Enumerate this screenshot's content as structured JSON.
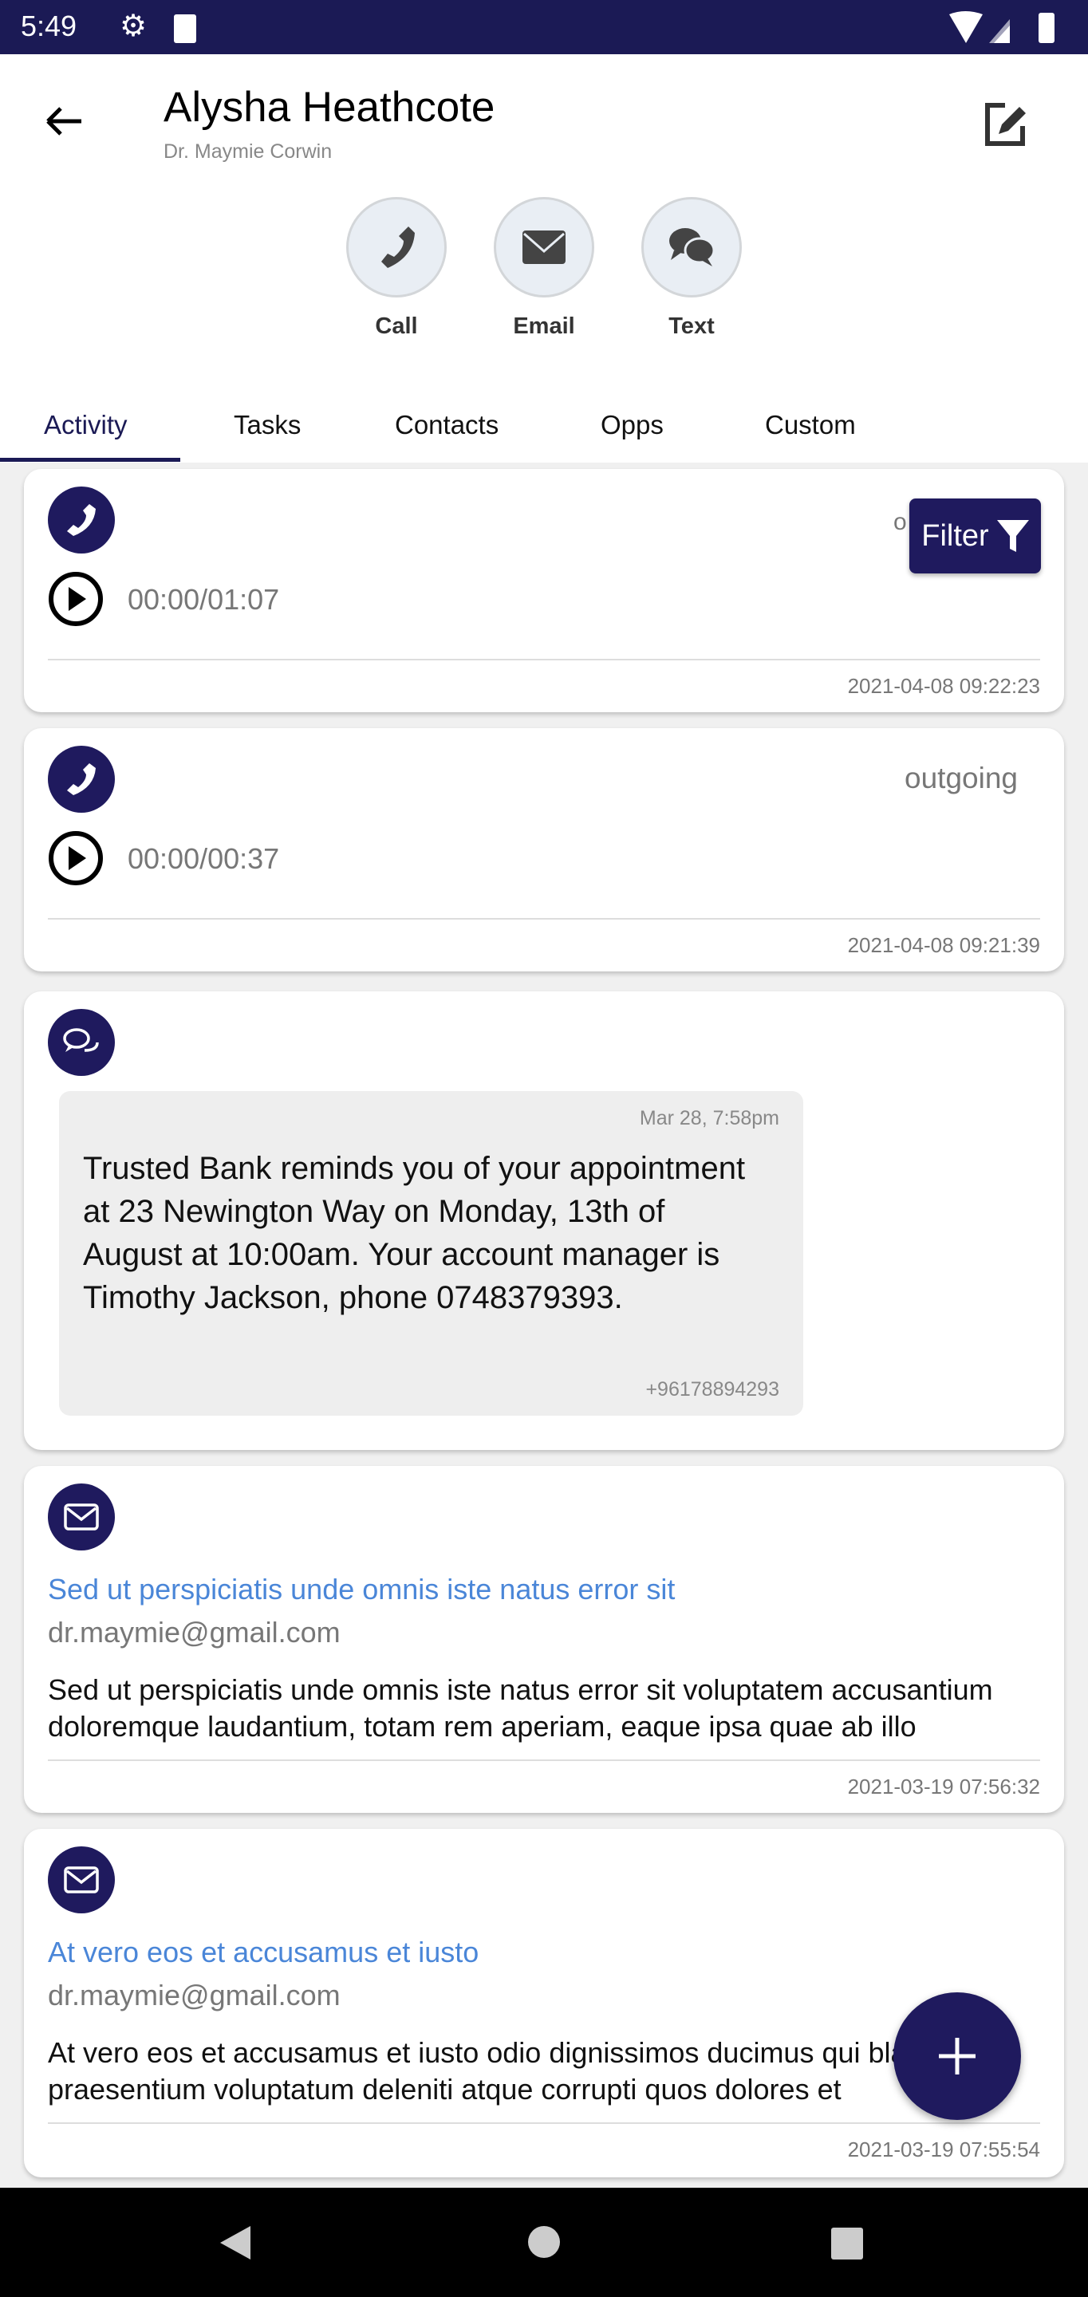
{
  "status_bar": {
    "time": "5:49",
    "color": "#1b1a55"
  },
  "header": {
    "title": "Alysha Heathcote",
    "subtitle": "Dr. Maymie Corwin"
  },
  "actions": [
    {
      "label": "Call",
      "icon": "phone-icon"
    },
    {
      "label": "Email",
      "icon": "envelope-icon"
    },
    {
      "label": "Text",
      "icon": "chat-icon"
    }
  ],
  "tabs": [
    {
      "label": "Activity",
      "active": true
    },
    {
      "label": "Tasks"
    },
    {
      "label": "Contacts"
    },
    {
      "label": "Opps"
    },
    {
      "label": "Custom"
    }
  ],
  "filter_label": "Filter",
  "accent": "#1f1a5e",
  "activities": [
    {
      "type": "call",
      "direction": "o",
      "duration": "00:00/01:07",
      "timestamp": "2021-04-08 09:22:23"
    },
    {
      "type": "call",
      "direction": "outgoing",
      "duration": "00:00/00:37",
      "timestamp": "2021-04-08 09:21:39"
    },
    {
      "type": "text",
      "date": "Mar 28, 7:58pm",
      "body": "Trusted Bank reminds you of your appointment at 23 Newington Way on Monday, 13th of August at 10:00am. Your account manager is Timothy Jackson, phone 0748379393.",
      "phone": "+96178894293"
    },
    {
      "type": "email",
      "subject": "Sed ut perspiciatis unde omnis iste natus error sit",
      "from": "dr.maymie@gmail.com",
      "preview": "Sed ut perspiciatis unde omnis iste natus error sit voluptatem accusantium doloremque laudantium, totam rem aperiam, eaque ipsa quae ab illo",
      "timestamp": "2021-03-19 07:56:32"
    },
    {
      "type": "email",
      "subject": "At vero eos et accusamus et iusto",
      "from": "dr.maymie@gmail.com",
      "preview": "At vero eos et accusamus et iusto odio dignissimos ducimus qui blanditiis praesentium voluptatum deleniti atque corrupti quos dolores et",
      "timestamp": "2021-03-19 07:55:54"
    }
  ]
}
